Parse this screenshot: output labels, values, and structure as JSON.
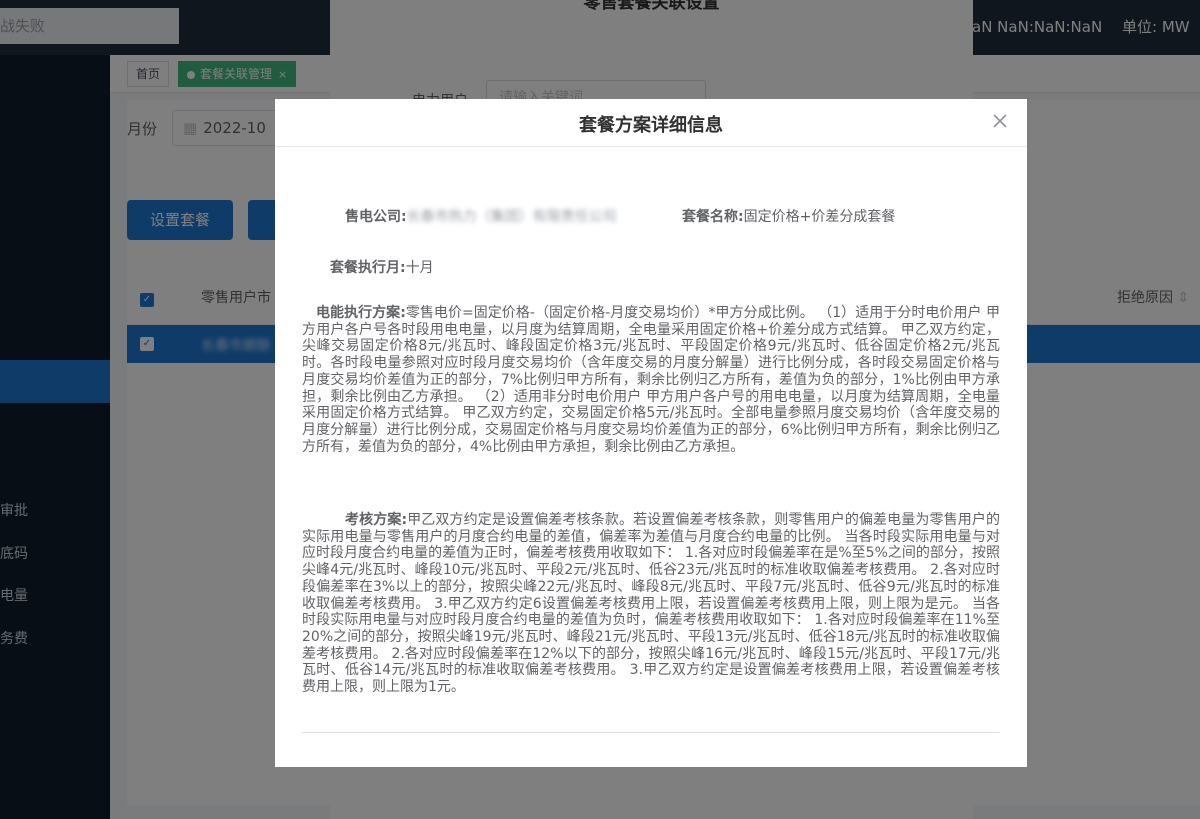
{
  "topbar": {
    "search_text": "战失败",
    "clock": "aN NaN:NaN:NaN",
    "unit": "单位: MW"
  },
  "sidebar": {
    "items": [
      "审批",
      "底码",
      "电量",
      "务费"
    ]
  },
  "tabs": {
    "home": "首页",
    "active": "套餐关联管理",
    "close": "×"
  },
  "toolbar": {
    "month_label": "月份",
    "month_value": "2022-10",
    "calendar_icon": "calendar-icon",
    "set_package_button": "设置套餐"
  },
  "table": {
    "col_user": "零售用户市",
    "col_reject": "拒绝原因",
    "row_blurred": "长春市朗联"
  },
  "back_dialog": {
    "title": "零售套餐关联设置",
    "user_label": "电力用户",
    "user_placeholder": "请输入关键词"
  },
  "dialog": {
    "title": "套餐方案详细信息",
    "close_icon": "close-icon",
    "company_label": "售电公司:",
    "company_value": "长春市热力（集团）有限责任公司",
    "package_label": "套餐名称:",
    "package_value": "固定价格+价差分成套餐",
    "exec_month_label": "套餐执行月:",
    "exec_month_value": "十月",
    "energy_label": "电能执行方案:",
    "energy_text": "零售电价=固定价格-（固定价格-月度交易均价）*甲方分成比例。 （1）适用于分时电价用户 甲方用户各户号各时段用电电量，以月度为结算周期，全电量采用固定价格+价差分成方式结算。 甲乙双方约定，尖峰交易固定价格8元/兆瓦时、峰段固定价格3元/兆瓦时、平段固定价格9元/兆瓦时、低谷固定价格2元/兆瓦时。各时段电量参照对应时段月度交易均价（含年度交易的月度分解量）进行比例分成，各时段交易固定价格与月度交易均价差值为正的部分，7%比例归甲方所有，剩余比例归乙方所有，差值为负的部分，1%比例由甲方承担，剩余比例由乙方承担。 （2）适用非分时电价用户 甲方用户各户号的用电电量，以月度为结算周期，全电量采用固定价格方式结算。 甲乙双方约定，交易固定价格5元/兆瓦时。全部电量参照月度交易均价（含年度交易的月度分解量）进行比例分成，交易固定价格与月度交易均价差值为正的部分，6%比例归甲方所有，剩余比例归乙方所有，差值为负的部分，4%比例由甲方承担，剩余比例由乙方承担。",
    "assess_label": "考核方案:",
    "assess_text": "甲乙双方约定是设置偏差考核条款。若设置偏差考核条款，则零售用户的偏差电量为零售用户的实际用电量与零售用户的月度合约电量的差值，偏差率为差值与月度合约电量的比例。 当各时段实际用电量与对应时段月度合约电量的差值为正时，偏差考核费用收取如下： 1.各对应时段偏差率在是%至5%之间的部分，按照尖峰4元/兆瓦时、峰段10元/兆瓦时、平段2元/兆瓦时、低谷23元/兆瓦时的标准收取偏差考核费用。 2.各对应时段偏差率在3%以上的部分，按照尖峰22元/兆瓦时、峰段8元/兆瓦时、平段7元/兆瓦时、低谷9元/兆瓦时的标准收取偏差考核费用。 3.甲乙双方约定6设置偏差考核费用上限，若设置偏差考核费用上限，则上限为是元。 当各时段实际用电量与对应时段月度合约电量的差值为负时，偏差考核费用收取如下： 1.各对应时段偏差率在11%至20%之间的部分，按照尖峰19元/兆瓦时、峰段21元/兆瓦时、平段13元/兆瓦时、低谷18元/兆瓦时的标准收取偏差考核费用。 2.各对应时段偏差率在12%以下的部分，按照尖峰16元/兆瓦时、峰段15元/兆瓦时、平段17元/兆瓦时、低谷14元/兆瓦时的标准收取偏差考核费用。 3.甲乙双方约定是设置偏差考核费用上限，若设置偏差考核费用上限，则上限为1元。"
  }
}
